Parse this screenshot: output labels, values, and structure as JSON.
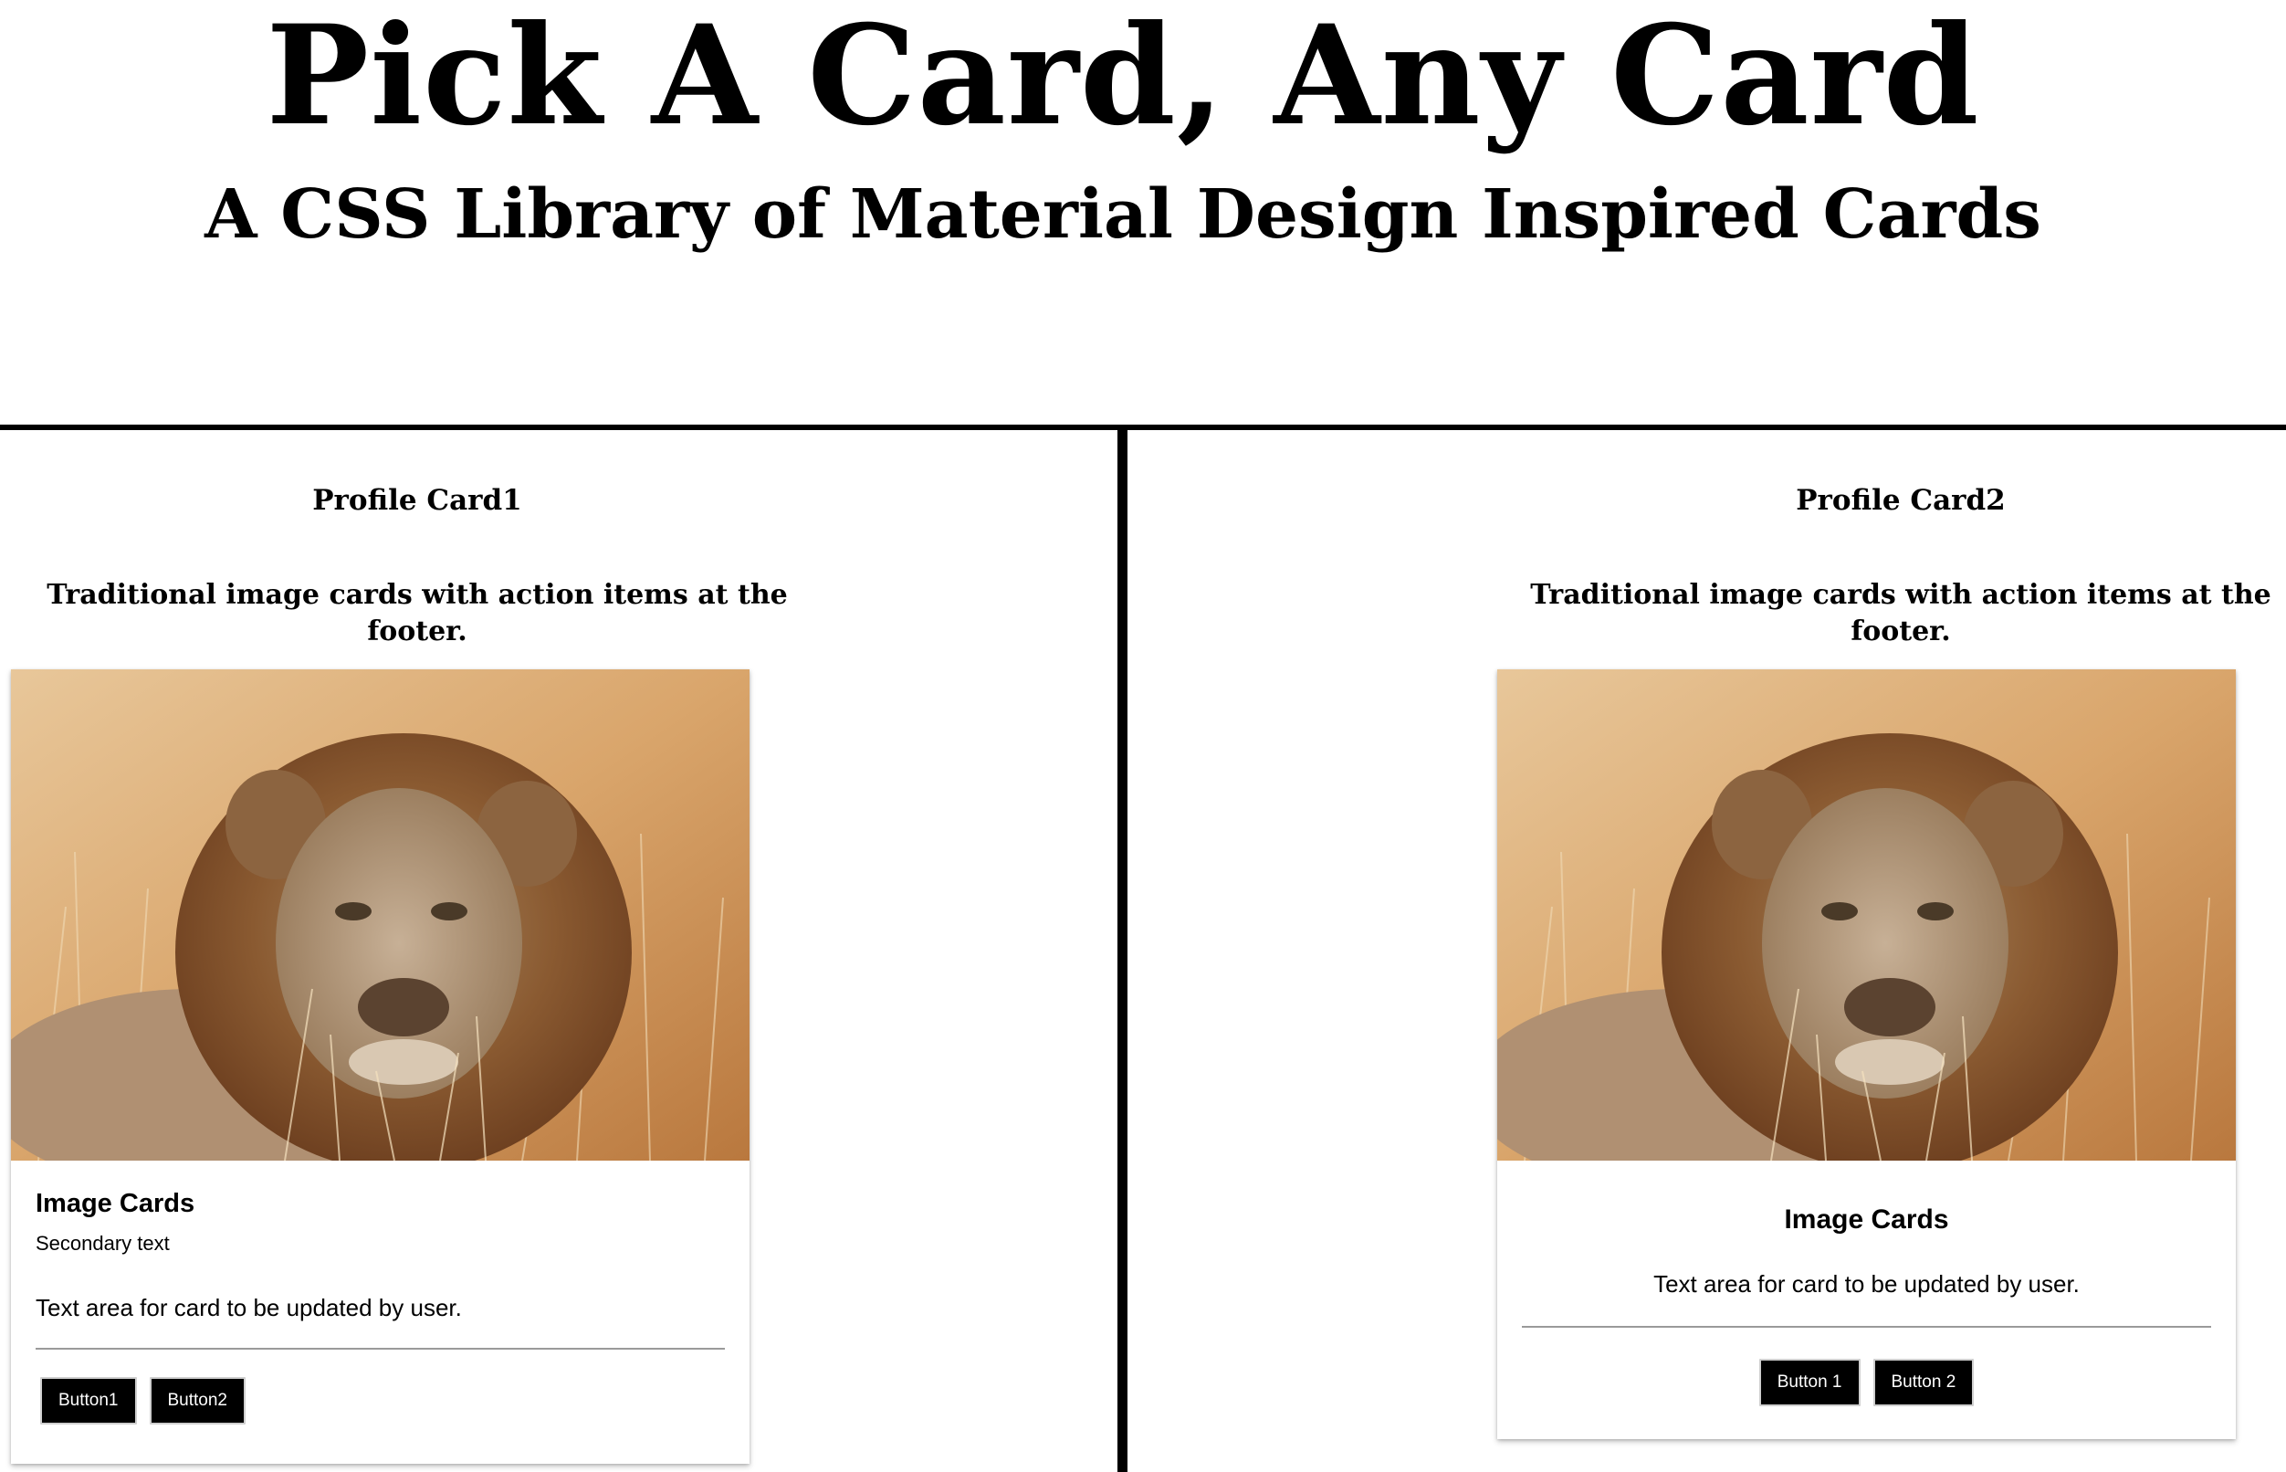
{
  "header": {
    "title": "Pick A Card, Any Card",
    "subtitle": "A CSS Library of Material Design Inspired Cards"
  },
  "sections": [
    {
      "title": "Profile Card1",
      "description": "Traditional image cards with action items at the footer.",
      "card": {
        "image_alt": "lion-photo",
        "title": "Image Cards",
        "secondary": "Secondary text",
        "text": "Text area for card to be updated by user.",
        "buttons": [
          "Button1",
          "Button2"
        ]
      }
    },
    {
      "title": "Profile Card2",
      "description": "Traditional image cards with action items at the footer.",
      "card": {
        "image_alt": "lion-photo",
        "title": "Image Cards",
        "text": "Text area for card to be updated by user.",
        "buttons": [
          "Button 1",
          "Button 2"
        ]
      }
    }
  ],
  "colors": {
    "background": "#ffffff",
    "text": "#000000",
    "button_bg": "#000000",
    "button_text": "#ffffff",
    "divider": "#000000"
  }
}
